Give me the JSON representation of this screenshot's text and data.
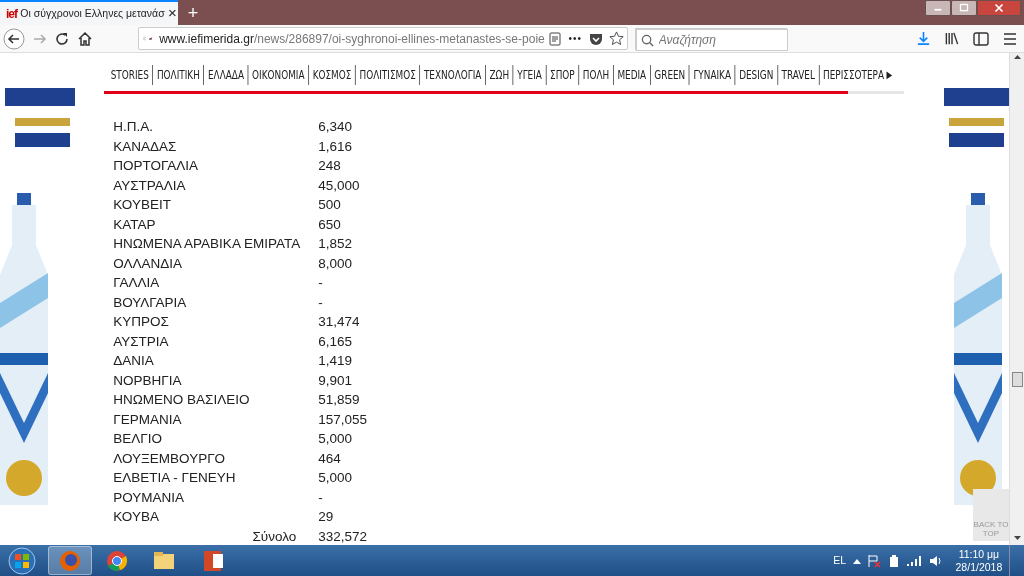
{
  "browser": {
    "tab": {
      "favicon": "ief",
      "title": "Οι σύγχρονοι Ελληνες μετανάσ",
      "close": "×",
      "selected": true
    },
    "new_tab": "+",
    "url": {
      "host": "www.iefimerida.gr",
      "path": "/news/286897/oi-syghronoi-ellines-metanastes-se-poie"
    },
    "search": {
      "placeholder": "Αναζήτηση"
    },
    "page_actions": "•••"
  },
  "site_nav": {
    "items": [
      {
        "label": "STORIES"
      },
      {
        "label": "ΠΟΛΙΤΙΚΗ"
      },
      {
        "label": "ΕΛΛΑΔΑ"
      },
      {
        "label": "ΟΙΚΟΝΟΜΙΑ"
      },
      {
        "label": "ΚΟΣΜΟΣ"
      },
      {
        "label": "ΠΟΛΙΤΙΣΜΟΣ"
      },
      {
        "label": "ΤΕΧΝΟΛΟΓΙΑ"
      },
      {
        "label": "ΖΩΗ"
      },
      {
        "label": "ΥΓΕΙΑ"
      },
      {
        "label": "ΣΠΟΡ"
      },
      {
        "label": "ΠΟΛΗ"
      },
      {
        "label": "MEDIA"
      },
      {
        "label": "GREEN"
      },
      {
        "label": "ΓΥΝΑΙΚΑ"
      },
      {
        "label": "DESIGN"
      },
      {
        "label": "TRAVEL"
      }
    ],
    "more": "ΠΕΡΙΣΣΟΤΕΡΑ",
    "more_arrow": "▶",
    "read_progress": {
      "level": 0.93
    }
  },
  "table": {
    "rows": [
      [
        "Η.Π.Α.",
        "6,340"
      ],
      [
        "ΚΑΝΑΔΑΣ",
        "1,616"
      ],
      [
        "ΠΟΡΤΟΓΑΛΙΑ",
        "248"
      ],
      [
        "ΑΥΣΤΡΑΛΙΑ",
        "45,000"
      ],
      [
        "ΚΟΥΒΕΙΤ",
        "500"
      ],
      [
        "ΚΑΤΑΡ",
        "650"
      ],
      [
        "ΗΝΩΜΕΝΑ ΑΡΑΒΙΚΑ ΕΜΙΡΑΤΑ",
        "1,852"
      ],
      [
        "ΟΛΛΑΝΔΙΑ",
        "8,000"
      ],
      [
        "ΓΑΛΛΙΑ",
        "-"
      ],
      [
        "ΒΟΥΛΓΑΡΙΑ",
        "-"
      ],
      [
        "ΚΥΠΡΟΣ",
        "31,474"
      ],
      [
        "ΑΥΣΤΡΙΑ",
        "6,165"
      ],
      [
        "ΔΑΝΙΑ",
        "1,419"
      ],
      [
        "ΝΟΡΒΗΓΙΑ",
        "9,901"
      ],
      [
        "ΗΝΩΜΕΝΟ ΒΑΣΙΛΕΙΟ",
        "51,859"
      ],
      [
        "ΓΕΡΜΑΝΙΑ",
        "157,055"
      ],
      [
        "ΒΕΛΓΙΟ",
        "5,000"
      ],
      [
        "ΛΟΥΞΕΜΒΟΥΡΓΟ",
        "464"
      ],
      [
        "ΕΛΒΕΤΙΑ - ΓΕΝΕΥΗ",
        "5,000"
      ],
      [
        "ΡΟΥΜΑΝΙΑ",
        "-"
      ],
      [
        "ΚΟΥΒΑ",
        "29"
      ]
    ],
    "total": {
      "label": "Σύνολο",
      "value": "332,572"
    }
  },
  "back_to_top": "BACK TO TOP",
  "taskbar": {
    "apps": [
      {
        "kind": "firefox",
        "selected": true
      },
      {
        "kind": "chrome",
        "selected": false
      },
      {
        "kind": "folder",
        "selected": false
      },
      {
        "kind": "powerpoint",
        "selected": false
      }
    ],
    "language": "EL",
    "time": "11:10 μμ",
    "date": "28/1/2018"
  }
}
